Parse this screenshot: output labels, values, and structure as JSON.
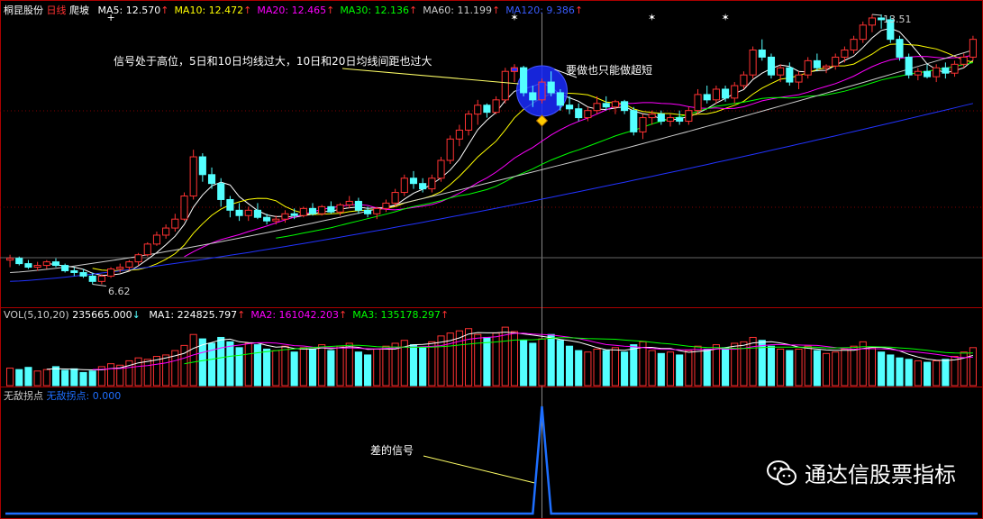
{
  "header": {
    "stock_name": "桐昆股份",
    "period": "日线",
    "indicator": "爬坡",
    "ma": [
      {
        "label": "MA5: 12.570",
        "arrow": "↑",
        "color": "#ffffff"
      },
      {
        "label": "MA10: 12.472",
        "arrow": "↑",
        "color": "#ffff00"
      },
      {
        "label": "MA20: 12.465",
        "arrow": "↑",
        "color": "#ff00ff"
      },
      {
        "label": "MA30: 12.136",
        "arrow": "↑",
        "color": "#00ff00"
      },
      {
        "label": "MA60: 11.199",
        "arrow": "↑",
        "color": "#cccccc"
      },
      {
        "label": "MA120: 9.386",
        "arrow": "↑",
        "color": "#3a5cff"
      }
    ]
  },
  "vol_header": {
    "prefix": "VOL(5,10,20)",
    "value": "235665.000",
    "value_arrow": "↓",
    "ma": [
      {
        "label": "MA1: 224825.797",
        "arrow": "↑",
        "color": "#ffffff"
      },
      {
        "label": "MA2: 161042.203",
        "arrow": "↑",
        "color": "#ff00ff"
      },
      {
        "label": "MA3: 135178.297",
        "arrow": "↑",
        "color": "#00ff00"
      }
    ]
  },
  "ind_header": {
    "name": "无敌拐点",
    "series_label": "无敌拐点: 0.000"
  },
  "annotations": {
    "high_position": "信号处于高位，5日和10日均线过大，10日和20日均线间距也过大",
    "only_short": "要做也只能做超短",
    "bad_signal": "差的信号",
    "price_high": "13.51",
    "price_low": "6.62"
  },
  "watermark": {
    "text": "通达信股票指标"
  },
  "colors": {
    "up": "#ff3232",
    "down": "#54ffff",
    "grid": "#800000",
    "signal": "#1e6fff",
    "highlight": "#1a2cff"
  },
  "chart_data": [
    {
      "type": "candlestick",
      "title": "桐昆股份 日线",
      "ylim": [
        6.0,
        14.2
      ],
      "candles": [
        [
          7.3,
          7.45,
          7.1,
          7.35
        ],
        [
          7.35,
          7.4,
          7.15,
          7.2
        ],
        [
          7.2,
          7.3,
          7.05,
          7.1
        ],
        [
          7.1,
          7.25,
          7.0,
          7.15
        ],
        [
          7.15,
          7.3,
          7.05,
          7.25
        ],
        [
          7.25,
          7.35,
          7.1,
          7.15
        ],
        [
          7.15,
          7.2,
          6.95,
          7.0
        ],
        [
          7.0,
          7.1,
          6.85,
          6.95
        ],
        [
          6.95,
          7.05,
          6.8,
          6.85
        ],
        [
          6.85,
          6.95,
          6.62,
          6.7
        ],
        [
          6.7,
          6.9,
          6.62,
          6.85
        ],
        [
          6.85,
          7.1,
          6.8,
          7.05
        ],
        [
          7.05,
          7.2,
          6.95,
          7.1
        ],
        [
          7.1,
          7.3,
          7.0,
          7.25
        ],
        [
          7.25,
          7.5,
          7.15,
          7.45
        ],
        [
          7.45,
          7.8,
          7.4,
          7.75
        ],
        [
          7.75,
          8.1,
          7.7,
          8.0
        ],
        [
          8.0,
          8.3,
          7.9,
          8.2
        ],
        [
          8.2,
          8.6,
          8.1,
          8.45
        ],
        [
          8.45,
          9.2,
          8.4,
          9.1
        ],
        [
          9.1,
          10.4,
          9.0,
          10.2
        ],
        [
          10.2,
          10.3,
          9.5,
          9.7
        ],
        [
          9.7,
          9.9,
          9.3,
          9.45
        ],
        [
          9.45,
          9.6,
          8.8,
          9.0
        ],
        [
          9.0,
          9.1,
          8.5,
          8.7
        ],
        [
          8.7,
          8.9,
          8.4,
          8.55
        ],
        [
          8.55,
          8.8,
          8.4,
          8.7
        ],
        [
          8.7,
          8.9,
          8.45,
          8.5
        ],
        [
          8.5,
          8.6,
          8.3,
          8.4
        ],
        [
          8.4,
          8.55,
          8.3,
          8.45
        ],
        [
          8.45,
          8.7,
          8.35,
          8.6
        ],
        [
          8.6,
          8.75,
          8.45,
          8.55
        ],
        [
          8.55,
          8.8,
          8.5,
          8.75
        ],
        [
          8.75,
          8.9,
          8.55,
          8.6
        ],
        [
          8.6,
          8.85,
          8.55,
          8.8
        ],
        [
          8.8,
          8.95,
          8.6,
          8.65
        ],
        [
          8.65,
          8.9,
          8.55,
          8.85
        ],
        [
          8.85,
          9.1,
          8.75,
          8.95
        ],
        [
          8.95,
          9.05,
          8.6,
          8.7
        ],
        [
          8.7,
          8.8,
          8.5,
          8.6
        ],
        [
          8.6,
          8.8,
          8.45,
          8.75
        ],
        [
          8.75,
          9.0,
          8.65,
          8.9
        ],
        [
          8.9,
          9.3,
          8.8,
          9.2
        ],
        [
          9.2,
          9.7,
          9.1,
          9.6
        ],
        [
          9.6,
          9.8,
          9.3,
          9.45
        ],
        [
          9.45,
          9.6,
          9.2,
          9.3
        ],
        [
          9.3,
          9.7,
          9.2,
          9.6
        ],
        [
          9.6,
          10.2,
          9.5,
          10.1
        ],
        [
          10.1,
          10.8,
          10.0,
          10.7
        ],
        [
          10.7,
          11.1,
          10.5,
          10.95
        ],
        [
          10.95,
          11.5,
          10.8,
          11.4
        ],
        [
          11.4,
          11.8,
          11.1,
          11.65
        ],
        [
          11.65,
          11.7,
          11.3,
          11.45
        ],
        [
          11.45,
          11.9,
          11.4,
          11.8
        ],
        [
          11.8,
          12.7,
          11.7,
          12.6
        ],
        [
          12.6,
          12.8,
          12.3,
          12.7
        ],
        [
          12.7,
          12.75,
          11.9,
          12.0
        ],
        [
          12.0,
          12.2,
          11.6,
          11.8
        ],
        [
          11.8,
          12.4,
          11.7,
          12.3
        ],
        [
          12.3,
          12.6,
          11.9,
          12.0
        ],
        [
          12.0,
          12.1,
          11.5,
          11.65
        ],
        [
          11.65,
          11.9,
          11.4,
          11.55
        ],
        [
          11.55,
          11.7,
          11.2,
          11.3
        ],
        [
          11.3,
          11.6,
          11.2,
          11.5
        ],
        [
          11.5,
          11.9,
          11.4,
          11.7
        ],
        [
          11.7,
          11.9,
          11.5,
          11.6
        ],
        [
          11.6,
          11.8,
          11.4,
          11.75
        ],
        [
          11.75,
          11.8,
          11.4,
          11.5
        ],
        [
          11.5,
          11.6,
          10.8,
          10.9
        ],
        [
          10.9,
          11.4,
          10.7,
          11.3
        ],
        [
          11.3,
          11.5,
          11.1,
          11.4
        ],
        [
          11.4,
          11.5,
          11.1,
          11.2
        ],
        [
          11.2,
          11.4,
          11.05,
          11.3
        ],
        [
          11.3,
          11.5,
          11.1,
          11.2
        ],
        [
          11.2,
          11.6,
          11.1,
          11.5
        ],
        [
          11.5,
          12.1,
          11.4,
          11.95
        ],
        [
          11.95,
          12.2,
          11.7,
          11.8
        ],
        [
          11.8,
          12.2,
          11.7,
          12.1
        ],
        [
          12.1,
          12.2,
          11.75,
          11.85
        ],
        [
          11.85,
          12.3,
          11.7,
          12.2
        ],
        [
          12.2,
          12.6,
          12.1,
          12.5
        ],
        [
          12.5,
          13.3,
          12.4,
          13.2
        ],
        [
          13.2,
          13.5,
          12.9,
          13.0
        ],
        [
          13.0,
          13.1,
          12.4,
          12.5
        ],
        [
          12.5,
          12.8,
          12.3,
          12.7
        ],
        [
          12.7,
          12.85,
          12.2,
          12.3
        ],
        [
          12.3,
          12.6,
          12.1,
          12.5
        ],
        [
          12.5,
          13.0,
          12.4,
          12.9
        ],
        [
          12.9,
          13.1,
          12.6,
          12.7
        ],
        [
          12.7,
          12.8,
          12.55,
          12.75
        ],
        [
          12.75,
          13.1,
          12.65,
          13.0
        ],
        [
          13.0,
          13.3,
          12.85,
          13.2
        ],
        [
          13.2,
          13.6,
          13.1,
          13.5
        ],
        [
          13.5,
          14.0,
          13.4,
          13.9
        ],
        [
          13.9,
          14.2,
          13.7,
          14.1
        ],
        [
          14.1,
          14.2,
          13.8,
          14.05
        ],
        [
          14.05,
          14.15,
          13.4,
          13.5
        ],
        [
          13.5,
          13.6,
          12.9,
          13.0
        ],
        [
          13.0,
          13.1,
          12.4,
          12.5
        ],
        [
          12.5,
          12.7,
          12.35,
          12.6
        ],
        [
          12.6,
          12.8,
          12.4,
          12.45
        ],
        [
          12.45,
          12.8,
          12.3,
          12.7
        ],
        [
          12.7,
          12.85,
          12.4,
          12.55
        ],
        [
          12.55,
          12.9,
          12.45,
          12.8
        ],
        [
          12.8,
          13.1,
          12.7,
          13.0
        ],
        [
          13.0,
          13.6,
          12.9,
          13.5
        ]
      ],
      "ma_periods": [
        5,
        10,
        20,
        30,
        60,
        120
      ],
      "ma_colors": [
        "#ffffff",
        "#ffff00",
        "#ff00ff",
        "#00ff00",
        "#cccccc",
        "#2233ff"
      ],
      "signal_index": 58,
      "high_label_index": 94,
      "low_label_index": 9,
      "star_indices": [
        11,
        55,
        70,
        78
      ],
      "ma120_start": 6.7,
      "ma120_end": 11.7,
      "ma60_start": 6.95,
      "ma60_end": 13.2
    },
    {
      "type": "bar",
      "title": "VOL(5,10,20)",
      "values": [
        24,
        22,
        25,
        20,
        22,
        26,
        21,
        23,
        18,
        20,
        26,
        30,
        28,
        34,
        38,
        36,
        40,
        42,
        48,
        55,
        70,
        64,
        58,
        66,
        60,
        52,
        58,
        56,
        50,
        48,
        54,
        46,
        52,
        50,
        56,
        48,
        54,
        58,
        46,
        42,
        50,
        54,
        58,
        62,
        56,
        52,
        60,
        68,
        72,
        75,
        78,
        70,
        66,
        72,
        80,
        74,
        62,
        58,
        64,
        70,
        62,
        54,
        48,
        46,
        50,
        48,
        52,
        46,
        56,
        60,
        48,
        44,
        46,
        42,
        48,
        54,
        50,
        56,
        52,
        58,
        60,
        66,
        62,
        54,
        50,
        48,
        50,
        54,
        48,
        44,
        46,
        50,
        54,
        60,
        52,
        46,
        42,
        38,
        36,
        34,
        32,
        34,
        36,
        40,
        46,
        52
      ],
      "ylim": [
        0,
        90
      ]
    },
    {
      "type": "line",
      "title": "无敌拐点",
      "values_note": "single spike at signal index",
      "spike_index": 58,
      "spike_value": 1,
      "base_value": 0,
      "ylim": [
        0,
        1.05
      ]
    }
  ]
}
